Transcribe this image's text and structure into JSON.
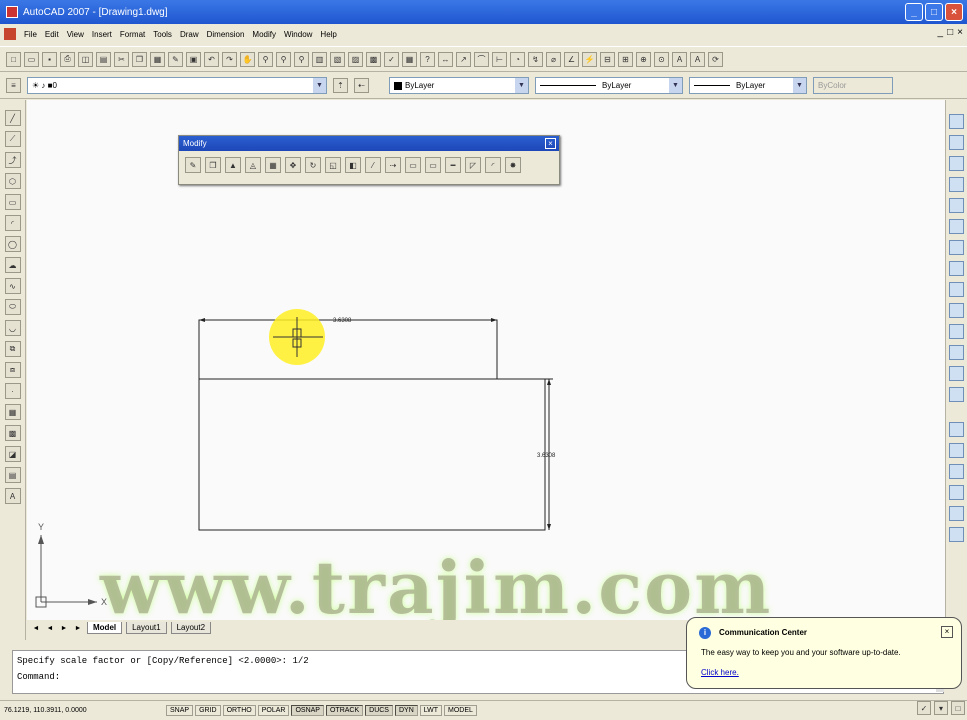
{
  "window": {
    "title": "AutoCAD 2007 - [Drawing1.dwg]",
    "controls": [
      "_",
      "□",
      "×"
    ]
  },
  "menu": {
    "items": [
      "File",
      "Edit",
      "View",
      "Insert",
      "Format",
      "Tools",
      "Draw",
      "Dimension",
      "Modify",
      "Window",
      "Help"
    ],
    "mdi_controls": [
      "_",
      "□",
      "×"
    ]
  },
  "layers_toolbar": {
    "layer_value": "0",
    "color_value": "ByLayer",
    "linetype_value": "ByLayer",
    "lineweight_value": "ByLayer",
    "plotstyle_value": "ByColor"
  },
  "modify_palette": {
    "title": "Modify",
    "close": "×",
    "icons": [
      "erase-icon",
      "copy-icon",
      "mirror-icon",
      "offset-icon",
      "array-icon",
      "move-icon",
      "rotate-icon",
      "scale-icon",
      "stretch-icon",
      "trim-icon",
      "extend-icon",
      "break-at-point-icon",
      "break-icon",
      "join-icon",
      "chamfer-icon",
      "fillet-icon",
      "explode-icon"
    ]
  },
  "drawing": {
    "dim_horizontal": "3.6308",
    "dim_vertical": "3.6308",
    "ucs_y": "Y",
    "ucs_x": "X"
  },
  "layout_tabs": {
    "nav": [
      "◄",
      "◄",
      "►",
      "►"
    ],
    "tabs": [
      {
        "label": "Model",
        "active": true
      },
      {
        "label": "Layout1",
        "active": false
      },
      {
        "label": "Layout2",
        "active": false
      }
    ]
  },
  "command_line": {
    "history": "Specify scale factor or [Copy/Reference] <2.0000>: 1/2",
    "prompt": "Command:"
  },
  "status_bar": {
    "coords": "76.1219, 110.3911, 0.0000",
    "buttons": [
      {
        "label": "SNAP",
        "on": false
      },
      {
        "label": "GRID",
        "on": false
      },
      {
        "label": "ORTHO",
        "on": false
      },
      {
        "label": "POLAR",
        "on": false
      },
      {
        "label": "OSNAP",
        "on": true
      },
      {
        "label": "OTRACK",
        "on": true
      },
      {
        "label": "DUCS",
        "on": true
      },
      {
        "label": "DYN",
        "on": true
      },
      {
        "label": "LWT",
        "on": false
      },
      {
        "label": "MODEL",
        "on": false
      }
    ]
  },
  "comm_center": {
    "title": "Communication Center",
    "body": "The easy way to keep you and your software up-to-date.",
    "link": "Click here.",
    "close": "×"
  },
  "watermark": "www.trajim.com",
  "colors": {
    "title_bar": "#1f56d0",
    "canvas": "#fafafa",
    "chrome": "#ece9d8",
    "highlight": "#ffee22"
  }
}
